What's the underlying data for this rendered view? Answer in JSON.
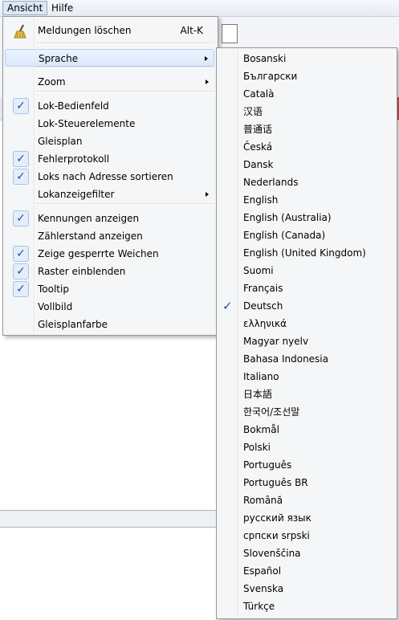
{
  "menubar": {
    "items": [
      "Ansicht",
      "Hilfe"
    ]
  },
  "view_menu": {
    "items": [
      {
        "label": "Meldungen löschen",
        "shortcut": "Alt-K",
        "icon": "broom-icon",
        "checked": false
      },
      {
        "label": "Sprache",
        "submenu": true,
        "checked": false
      },
      {
        "label": "Zoom",
        "submenu": true,
        "checked": false
      },
      {
        "label": "Lok-Bedienfeld",
        "checked": true
      },
      {
        "label": "Lok-Steuerelemente",
        "checked": false
      },
      {
        "label": "Gleisplan",
        "checked": false
      },
      {
        "label": "Fehlerprotokoll",
        "checked": true
      },
      {
        "label": "Loks nach Adresse sortieren",
        "checked": true
      },
      {
        "label": "Lokanzeigefilter",
        "submenu": true,
        "checked": false
      },
      {
        "label": "Kennungen anzeigen",
        "checked": true
      },
      {
        "label": "Zählerstand anzeigen",
        "checked": false
      },
      {
        "label": "Zeige gesperrte Weichen",
        "checked": true
      },
      {
        "label": "Raster einblenden",
        "checked": true
      },
      {
        "label": "Tooltip",
        "checked": true
      },
      {
        "label": "Vollbild",
        "checked": false
      },
      {
        "label": "Gleisplanfarbe",
        "checked": false
      }
    ]
  },
  "language_menu": {
    "items": [
      {
        "label": "Bosanski",
        "checked": false
      },
      {
        "label": "Български",
        "checked": false
      },
      {
        "label": "Català",
        "checked": false
      },
      {
        "label": "汉语",
        "checked": false
      },
      {
        "label": "普通话",
        "checked": false
      },
      {
        "label": "Česká",
        "checked": false
      },
      {
        "label": "Dansk",
        "checked": false
      },
      {
        "label": "Nederlands",
        "checked": false
      },
      {
        "label": "English",
        "checked": false
      },
      {
        "label": "English (Australia)",
        "checked": false
      },
      {
        "label": "English (Canada)",
        "checked": false
      },
      {
        "label": "English (United Kingdom)",
        "checked": false
      },
      {
        "label": "Suomi",
        "checked": false
      },
      {
        "label": "Français",
        "checked": false
      },
      {
        "label": "Deutsch",
        "checked": true
      },
      {
        "label": "ελληνικά",
        "checked": false
      },
      {
        "label": "Magyar nyelv",
        "checked": false
      },
      {
        "label": "Bahasa Indonesia",
        "checked": false
      },
      {
        "label": "Italiano",
        "checked": false
      },
      {
        "label": "日本語",
        "checked": false
      },
      {
        "label": "한국어/조선말",
        "checked": false
      },
      {
        "label": "Bokmål",
        "checked": false
      },
      {
        "label": "Polski",
        "checked": false
      },
      {
        "label": "Português",
        "checked": false
      },
      {
        "label": "Português BR",
        "checked": false
      },
      {
        "label": "Română",
        "checked": false
      },
      {
        "label": "русский язык",
        "checked": false
      },
      {
        "label": "српски srpski",
        "checked": false
      },
      {
        "label": "Slovenščina",
        "checked": false
      },
      {
        "label": "Español",
        "checked": false
      },
      {
        "label": "Svenska",
        "checked": false
      },
      {
        "label": "Türkçe",
        "checked": false
      }
    ]
  }
}
